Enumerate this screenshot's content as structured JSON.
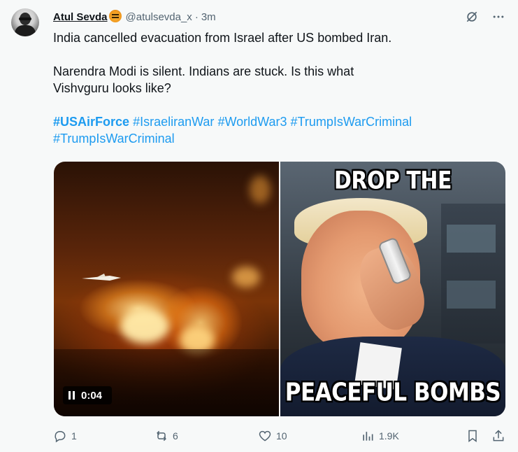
{
  "author": {
    "display_name": "Atul Sevda",
    "emoji_icon": "tiger-face-emoji",
    "handle": "@atulsevda_x",
    "separator": "·",
    "time": "3m"
  },
  "tweet": {
    "paragraph1": "India cancelled evacuation from Israel after US bombed Iran.",
    "paragraph2_line1": "Narendra Modi is silent. Indians are stuck. Is this what",
    "paragraph2_line2": "Vishvguru looks like?",
    "hashtags_line1": [
      "#USAirForce",
      "#IsraeliranWar",
      "#WorldWar3",
      "#TrumpIsWarCriminal"
    ],
    "hashtags_line2": [
      "#TrumpIsWarCriminal"
    ]
  },
  "media": {
    "video": {
      "duration": "0:04",
      "state_icon": "pause-icon"
    },
    "meme": {
      "top_text": "DROP THE",
      "bottom_text": "PEACEFUL BOMBS"
    }
  },
  "actions": {
    "reply_count": "1",
    "repost_count": "6",
    "like_count": "10",
    "views_count": "1.9K"
  },
  "colors": {
    "link": "#1d9bf0",
    "muted": "#536471",
    "text": "#0f1419",
    "background": "#f7f9f9"
  }
}
